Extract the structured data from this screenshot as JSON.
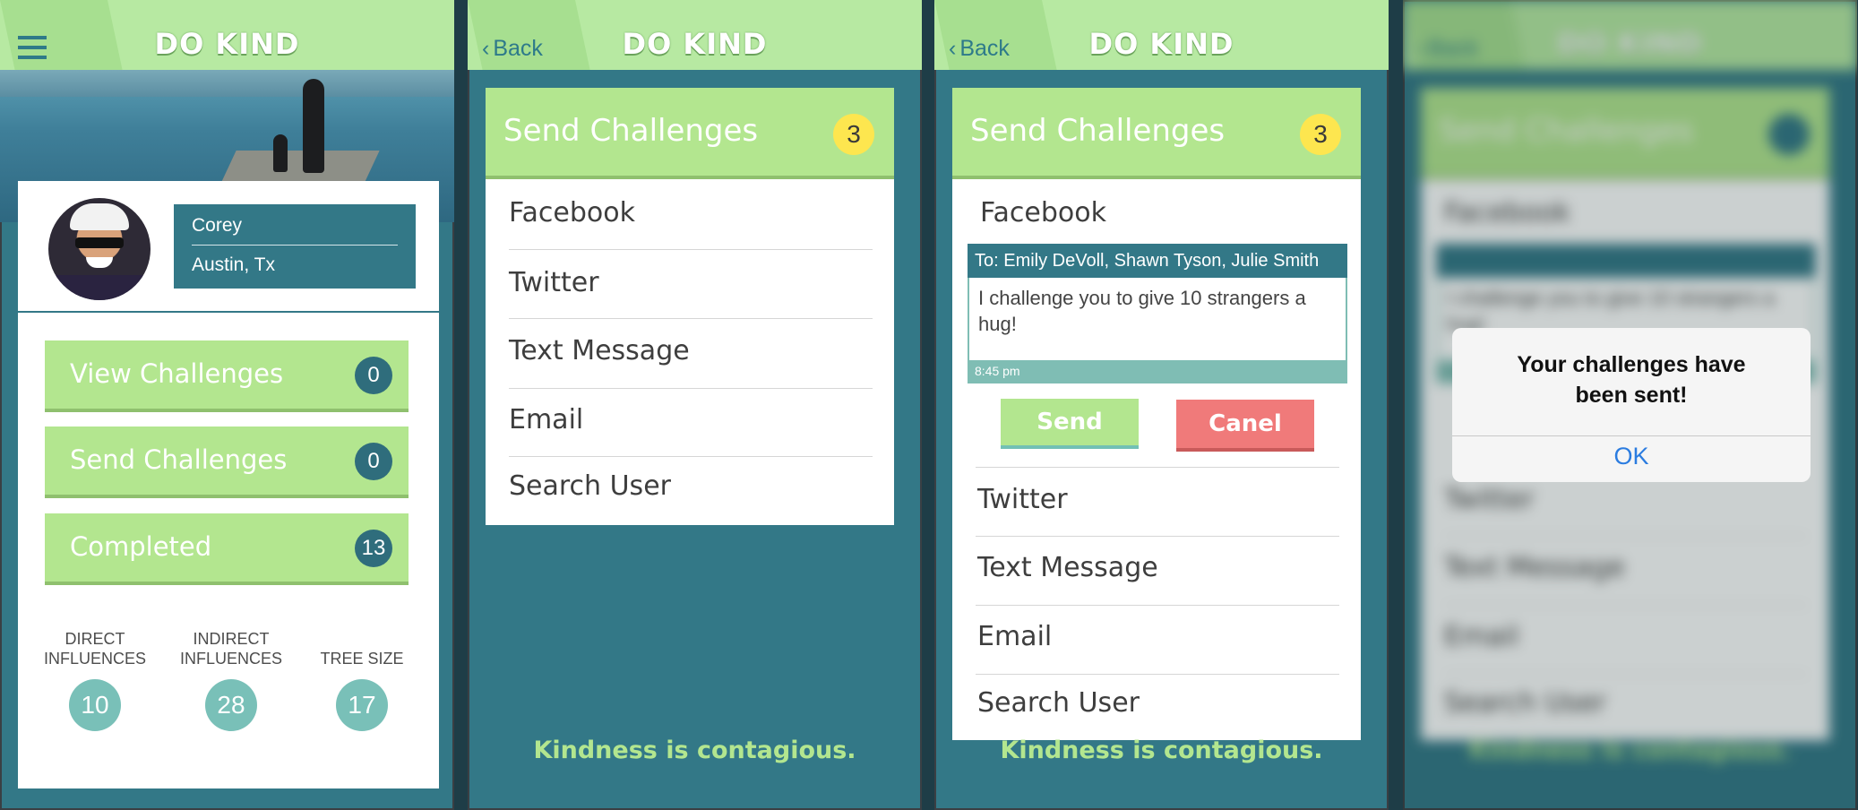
{
  "app_title": "DO KIND",
  "back_label": "Back",
  "tagline": "Kindness is contagious.",
  "profile": {
    "name": "Corey",
    "location": "Austin, Tx",
    "buttons": [
      {
        "label": "View Challenges",
        "count": "0"
      },
      {
        "label": "Send Challenges",
        "count": "0"
      },
      {
        "label": "Completed",
        "count": "13"
      }
    ],
    "stats": [
      {
        "label": "DIRECT\nINFLUENCES",
        "value": "10"
      },
      {
        "label": "INDIRECT\nINFLUENCES",
        "value": "28"
      },
      {
        "label": "TREE SIZE",
        "value": "17"
      }
    ]
  },
  "send": {
    "header": "Send Challenges",
    "badge": "3",
    "options": [
      "Facebook",
      "Twitter",
      "Text Message",
      "Email",
      "Search User"
    ]
  },
  "compose": {
    "to": "To: Emily DeVoll, Shawn Tyson, Julie Smith",
    "message": "I challenge you to give 10 strangers a hug!",
    "time": "8:45 pm",
    "send_label": "Send",
    "cancel_label": "Canel"
  },
  "alert": {
    "message": "Your challenges have been sent!",
    "ok": "OK"
  },
  "colors": {
    "teal": "#337887",
    "green": "#b3e68f",
    "topbar": "#b7e9a2",
    "badge_yellow": "#fde64f",
    "cancel_red": "#f07a7a",
    "ios_blue": "#2b7ce0"
  }
}
